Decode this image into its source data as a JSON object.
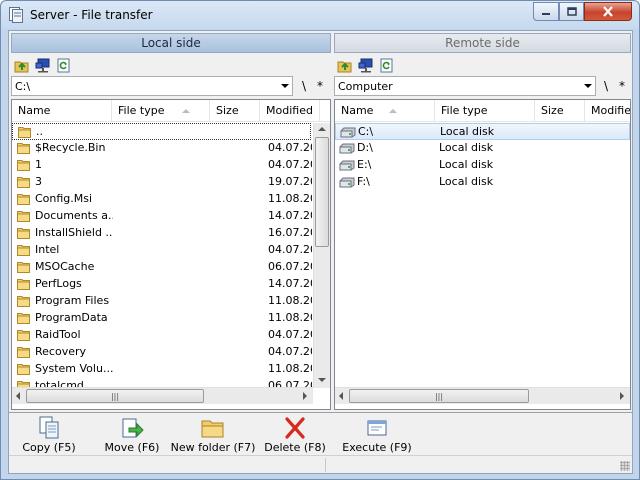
{
  "window": {
    "title": "Server - File transfer"
  },
  "left_panel": {
    "header": "Local side",
    "path": "C:\\",
    "sep_slash": "\\",
    "sep_star": "*",
    "columns": [
      "Name",
      "File type",
      "Size",
      "Modified"
    ],
    "sorted_column": "File type",
    "rows": [
      {
        "name": "..",
        "date": ""
      },
      {
        "name": "$Recycle.Bin",
        "date": "04.07.20"
      },
      {
        "name": "1",
        "date": "04.07.20"
      },
      {
        "name": "3",
        "date": "19.07.20"
      },
      {
        "name": "Config.Msi",
        "date": "11.08.20"
      },
      {
        "name": "Documents a...",
        "date": "14.07.20"
      },
      {
        "name": "InstallShield ...",
        "date": "16.07.20"
      },
      {
        "name": "Intel",
        "date": "04.07.20"
      },
      {
        "name": "MSOCache",
        "date": "06.07.20"
      },
      {
        "name": "PerfLogs",
        "date": "14.07.20"
      },
      {
        "name": "Program Files",
        "date": "11.08.20"
      },
      {
        "name": "ProgramData",
        "date": "11.08.20"
      },
      {
        "name": "RaidTool",
        "date": "04.07.20"
      },
      {
        "name": "Recovery",
        "date": "04.07.20"
      },
      {
        "name": "System Volu...",
        "date": "11.08.20"
      },
      {
        "name": "totalcmd",
        "date": "06.07.20"
      }
    ]
  },
  "right_panel": {
    "header": "Remote side",
    "path": "Computer",
    "sep_slash": "\\",
    "sep_star": "*",
    "columns": [
      "Name",
      "File type",
      "Size",
      "Modified"
    ],
    "sorted_column": "Name",
    "rows": [
      {
        "name": "C:\\",
        "type": "Local disk"
      },
      {
        "name": "D:\\",
        "type": "Local disk"
      },
      {
        "name": "E:\\",
        "type": "Local disk"
      },
      {
        "name": "F:\\",
        "type": "Local disk"
      }
    ]
  },
  "scrollbar_grip": "|||",
  "actions": [
    {
      "label": "Copy (F5)",
      "icon": "copy-icon"
    },
    {
      "label": "Move (F6)",
      "icon": "move-icon"
    },
    {
      "label": "New folder (F7)",
      "icon": "new-folder-icon"
    },
    {
      "label": "Delete (F8)",
      "icon": "delete-icon"
    },
    {
      "label": "Execute (F9)",
      "icon": "execute-icon"
    }
  ],
  "colors": {
    "selection": "#dbe9fa",
    "folder": "#e8c35a",
    "close_button": "#c7432b",
    "left_header": "#a9c1de",
    "right_header": "#d4dae2"
  }
}
